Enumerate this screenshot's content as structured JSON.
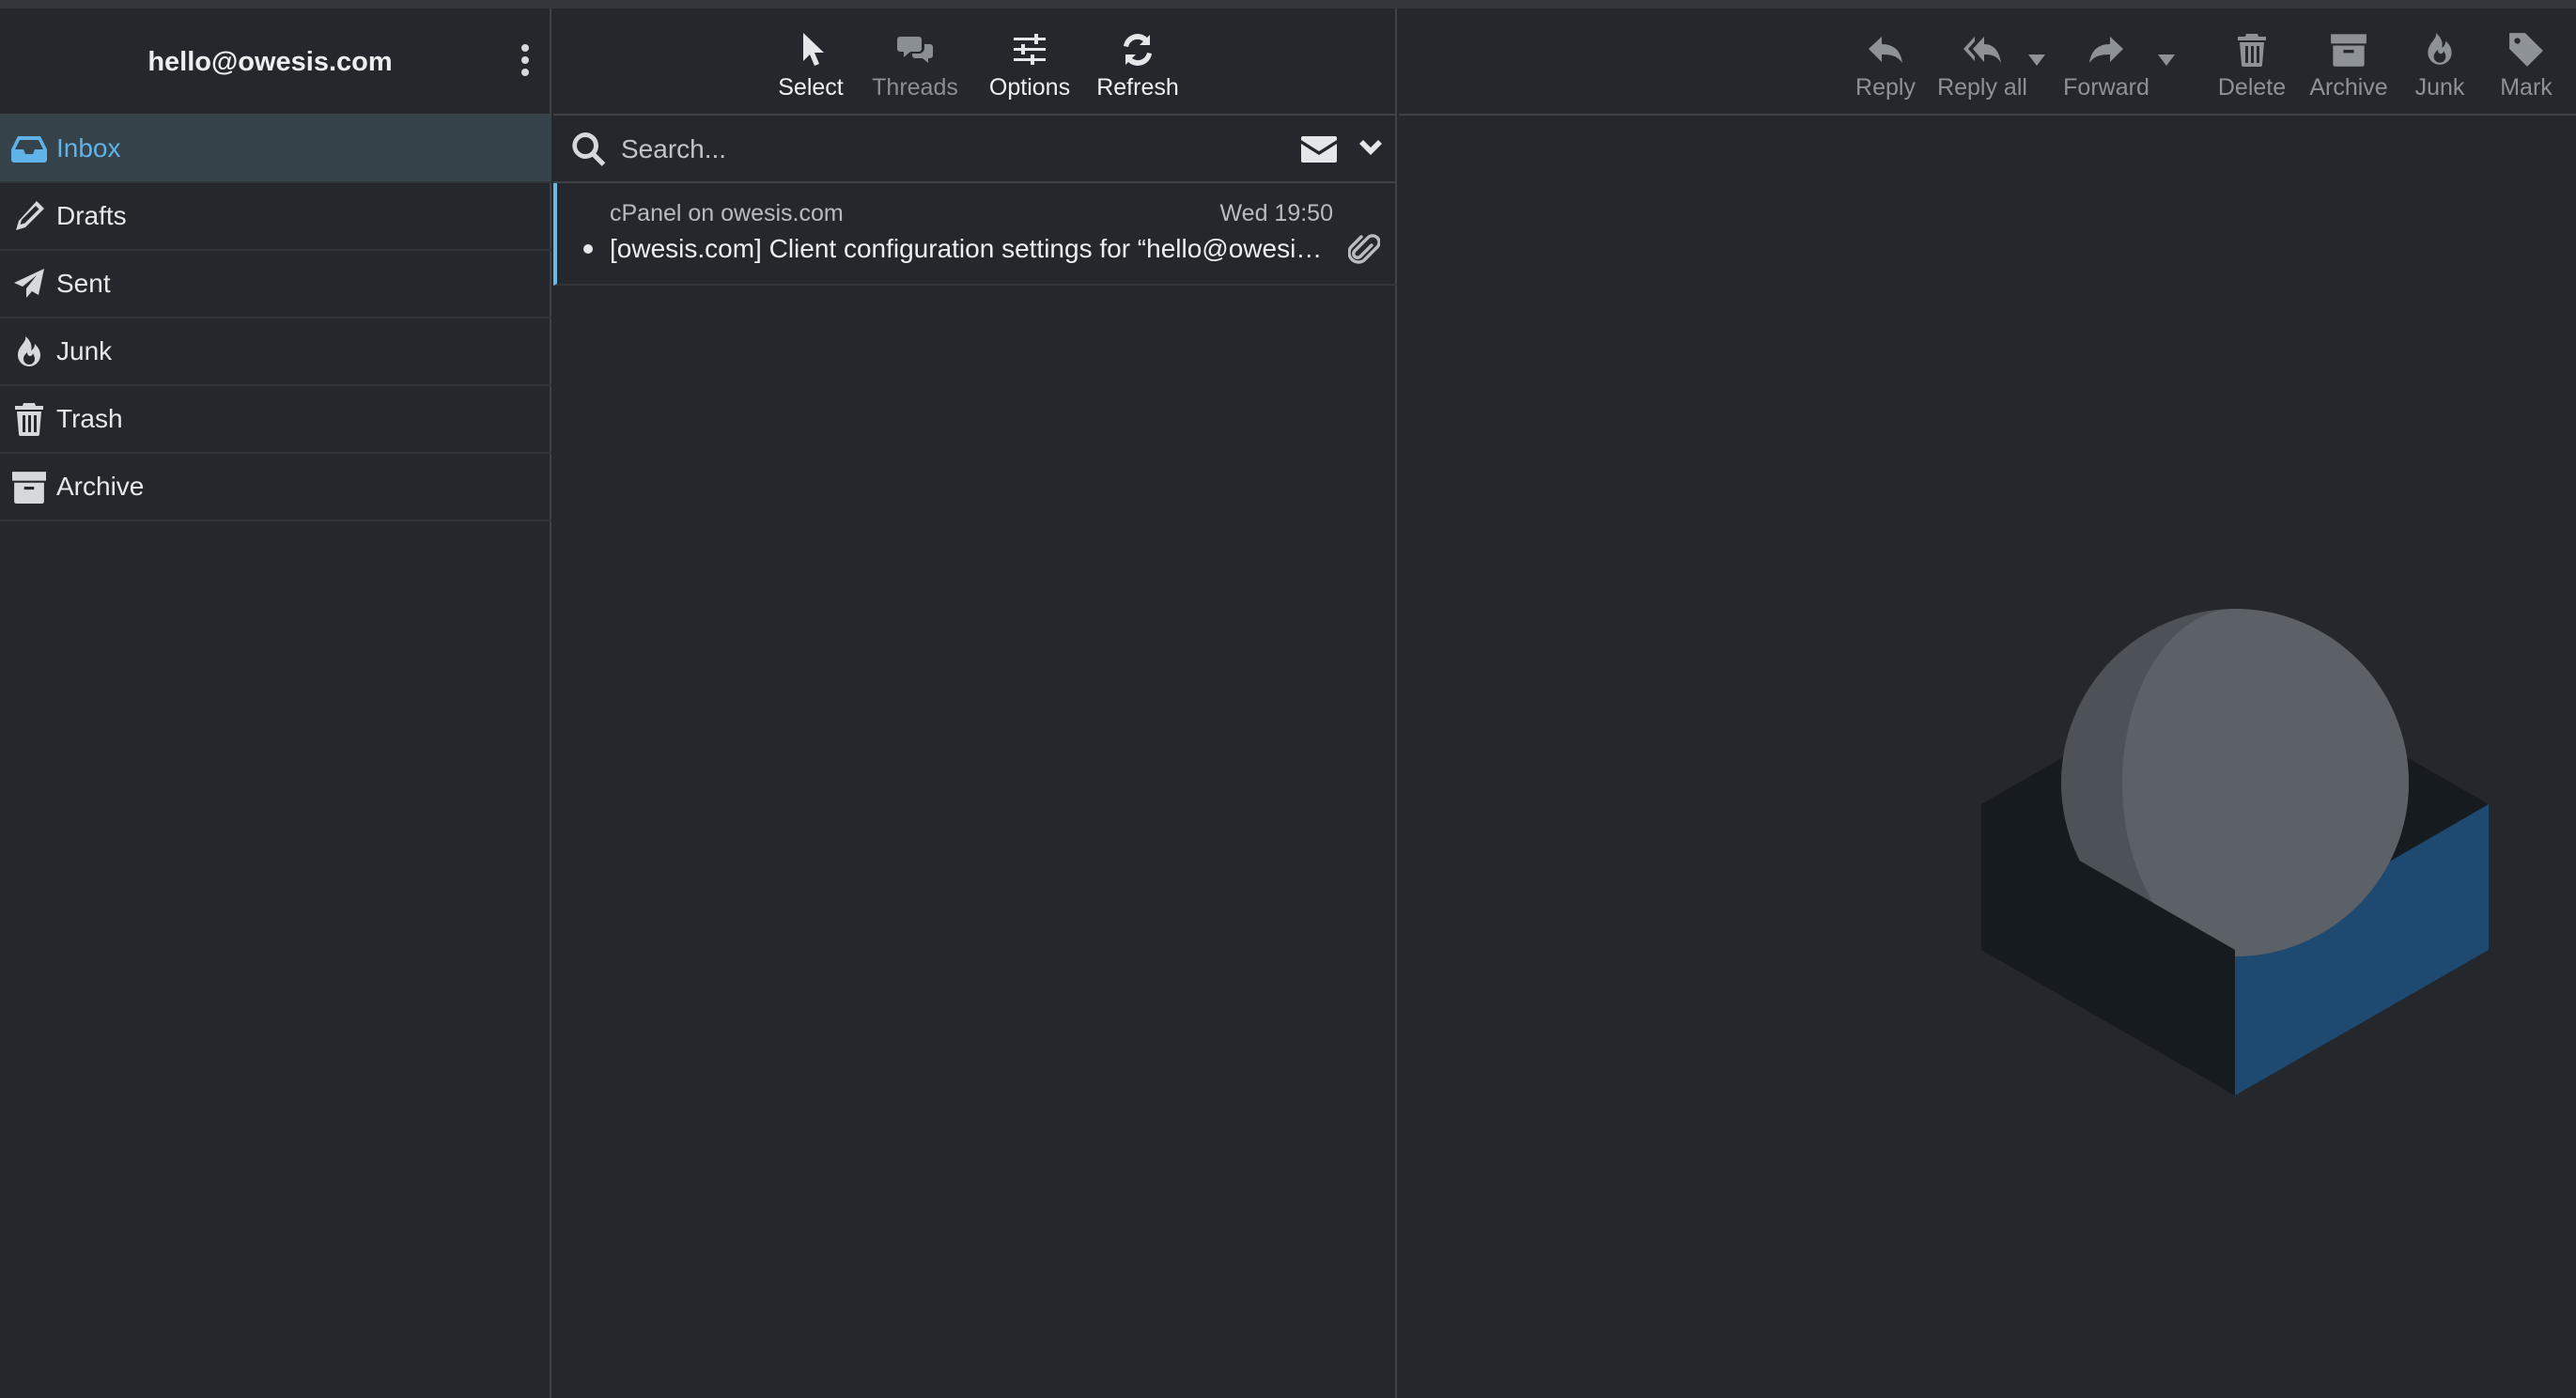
{
  "account": {
    "email": "hello@owesis.com"
  },
  "folders": [
    {
      "id": "inbox",
      "label": "Inbox",
      "icon": "inbox-icon",
      "active": true
    },
    {
      "id": "drafts",
      "label": "Drafts",
      "icon": "pencil-icon",
      "active": false
    },
    {
      "id": "sent",
      "label": "Sent",
      "icon": "paper-plane-icon",
      "active": false
    },
    {
      "id": "junk",
      "label": "Junk",
      "icon": "fire-icon",
      "active": false
    },
    {
      "id": "trash",
      "label": "Trash",
      "icon": "trash-icon",
      "active": false
    },
    {
      "id": "archive",
      "label": "Archive",
      "icon": "archive-box-icon",
      "active": false
    }
  ],
  "list_toolbar": {
    "select": "Select",
    "threads": "Threads",
    "options": "Options",
    "refresh": "Refresh"
  },
  "search": {
    "placeholder": "Search..."
  },
  "messages": [
    {
      "from": "cPanel on owesis.com",
      "date": "Wed 19:50",
      "subject": "[owesis.com] Client configuration settings for “hello@owesis.com”.",
      "unread": true,
      "has_attachment": true
    }
  ],
  "preview_toolbar": {
    "reply": "Reply",
    "reply_all": "Reply all",
    "forward": "Forward",
    "delete": "Delete",
    "archive": "Archive",
    "junk": "Junk",
    "mark": "Mark"
  },
  "colors": {
    "background": "#24282c",
    "accent": "#5fb3e9",
    "active_row": "#37434a",
    "disabled": "#8d9297"
  }
}
